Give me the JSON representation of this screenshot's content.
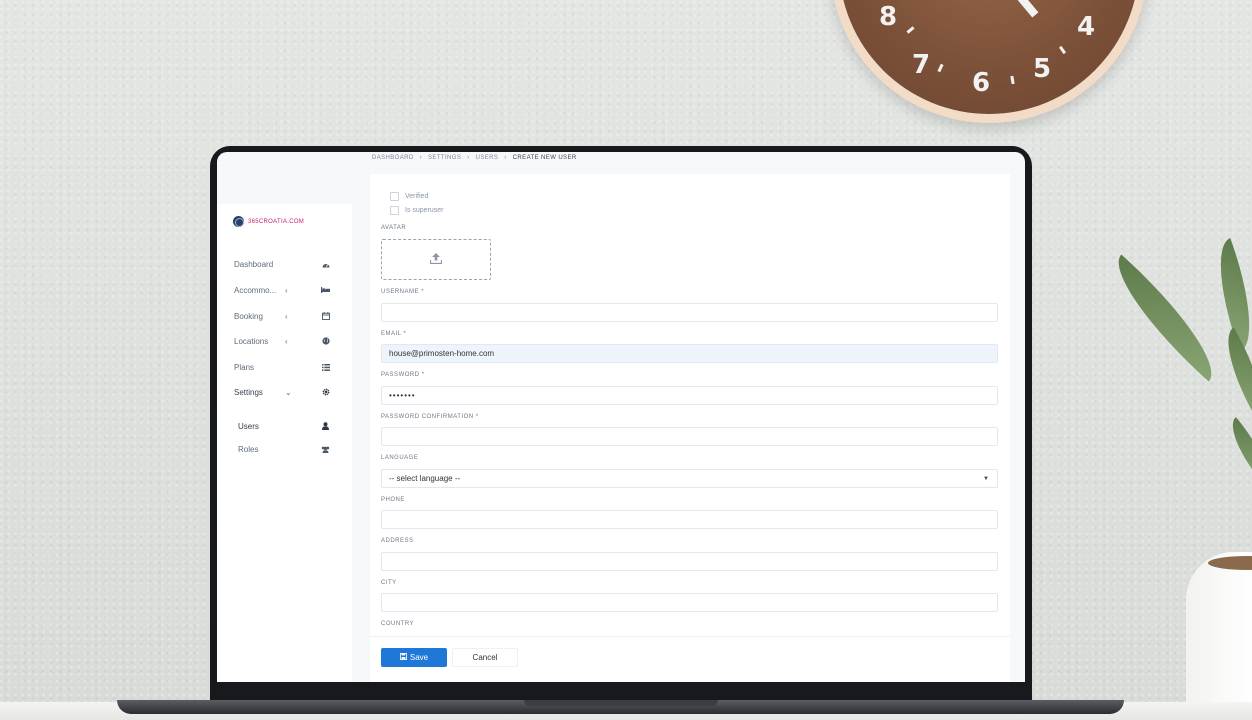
{
  "clock": {
    "numbers": [
      "8",
      "7",
      "6",
      "5",
      "4"
    ]
  },
  "app": {
    "brand": "365CROATIA.COM",
    "breadcrumb": [
      "DASHBOARD",
      "SETTINGS",
      "USERS",
      "CREATE NEW USER"
    ],
    "sidebar": {
      "items": [
        {
          "label": "Dashboard",
          "icon": "dashboard-icon",
          "chevron": ""
        },
        {
          "label": "Accommo...",
          "icon": "bed-icon",
          "chevron": "‹"
        },
        {
          "label": "Booking",
          "icon": "calendar-icon",
          "chevron": "‹"
        },
        {
          "label": "Locations",
          "icon": "globe-icon",
          "chevron": "‹"
        },
        {
          "label": "Plans",
          "icon": "list-icon",
          "chevron": ""
        },
        {
          "label": "Settings",
          "icon": "gear-icon",
          "chevron": "⌄"
        }
      ],
      "subitems": [
        {
          "label": "Users",
          "icon": "user-icon"
        },
        {
          "label": "Roles",
          "icon": "users-icon"
        }
      ]
    },
    "form": {
      "checkboxes": [
        {
          "label": "Verified",
          "checked": false
        },
        {
          "label": "Is superuser",
          "checked": false
        }
      ],
      "avatar_label": "AVATAR",
      "username": {
        "label": "USERNAME *",
        "value": ""
      },
      "email": {
        "label": "EMAIL *",
        "value": "house@primosten-home.com"
      },
      "password": {
        "label": "PASSWORD *",
        "value": "•••••••"
      },
      "password_confirmation": {
        "label": "PASSWORD CONFIRMATION *",
        "value": ""
      },
      "language": {
        "label": "LANGUAGE",
        "value": "-- select language --"
      },
      "phone": {
        "label": "PHONE",
        "value": ""
      },
      "address": {
        "label": "ADDRESS",
        "value": ""
      },
      "city": {
        "label": "CITY",
        "value": ""
      },
      "country": {
        "label": "COUNTRY",
        "value": ""
      }
    },
    "actions": {
      "save_label": "Save",
      "cancel_label": "Cancel"
    },
    "colors": {
      "primary": "#1f78d8",
      "brand_text": "#c21f6b",
      "filled_field": "#edf4fb"
    }
  }
}
